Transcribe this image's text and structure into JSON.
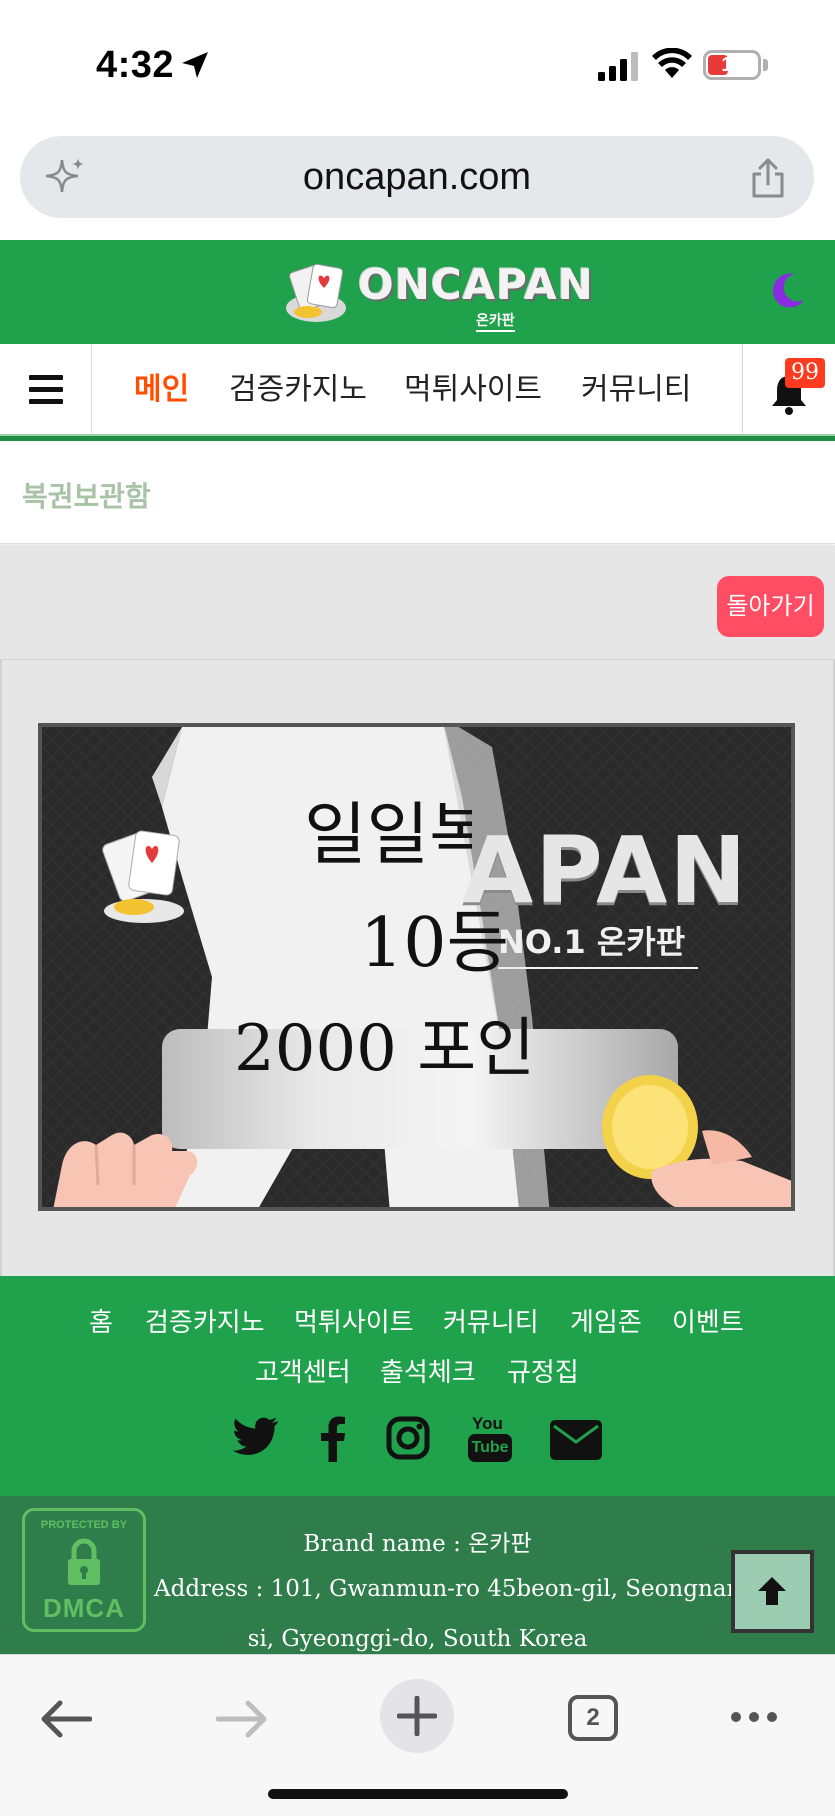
{
  "status_bar": {
    "time": "4:32",
    "battery": "11"
  },
  "browser": {
    "url": "oncapan.com",
    "tab_count": "2"
  },
  "site": {
    "logo_text": "ONCAPAN",
    "logo_sub": "온카판"
  },
  "nav": {
    "items": [
      {
        "label": "메인",
        "active": true
      },
      {
        "label": "검증카지노",
        "active": false
      },
      {
        "label": "먹튀사이트",
        "active": false
      },
      {
        "label": "커뮤니티",
        "active": false
      }
    ],
    "notification_count": "99"
  },
  "breadcrumb": {
    "title": "복권보관함"
  },
  "content": {
    "back_button": "돌아가기",
    "banner": {
      "brand": "APAN",
      "sub": "NO.1 온카판",
      "line1": "일일복권",
      "line2": "10등",
      "line3": "2000 포인트"
    }
  },
  "footer": {
    "links": [
      "홈",
      "검증카지노",
      "먹튀사이트",
      "커뮤니티",
      "게임존",
      "이벤트",
      "고객센터",
      "출석체크",
      "규정집"
    ],
    "social_icons": [
      "twitter-icon",
      "facebook-icon",
      "instagram-icon",
      "youtube-icon",
      "email-icon"
    ],
    "youtube_top": "You",
    "youtube_bottom": "Tube",
    "dmca_badge_top": "PROTECTED BY",
    "dmca_badge": "DMCA",
    "brand_line": "Brand name : 온카판",
    "address_line1": "Address : 101, Gwanmun-ro 45beon-gil, Seongnam-",
    "address_line2": "si, Gyeonggi-do, South Korea"
  },
  "colors": {
    "brand_green": "#1fa24b",
    "footer_dark_green": "#2f7d4b",
    "active_nav": "#ff4e00",
    "back_button": "#ff4d63",
    "badge_red": "#ff3b1f",
    "moon_purple": "#8a2be2"
  }
}
